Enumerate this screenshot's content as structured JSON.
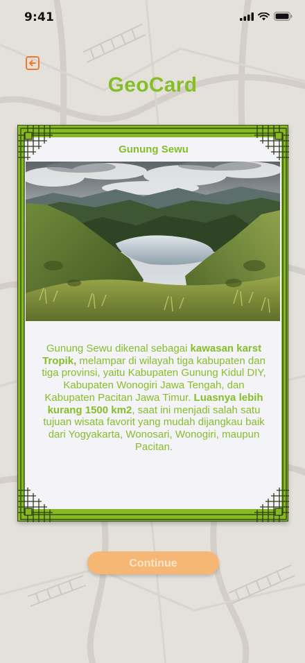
{
  "status_bar": {
    "time": "9:41"
  },
  "header": {
    "title": "GeoCard"
  },
  "card": {
    "title": "Gunung Sewu",
    "description_parts": [
      "Gunung Sewu dikenal sebagai ",
      "kawasan karst Tropik,",
      " melampar di wilayah tiga kabupaten dan tiga provinsi, yaitu Kabupaten Gunung Kidul DIY, Kabupaten Wonogiri Jawa Tengah, dan Kabupaten Pacitan Jawa Timur.  ",
      "Luasnya lebih kurang 1500 km2",
      ", saat ini menjadi salah satu tujuan wisata favorit yang mudah dijangkau baik dari Yogyakarta, Wonosari, Wonogiri, maupun Pacitan."
    ]
  },
  "actions": {
    "continue_label": "Continue"
  },
  "colors": {
    "accent": "#86be2a",
    "card_frame": "#84bb22",
    "button": "#f6b774",
    "back_icon": "#f07a2a"
  },
  "icons": {
    "back": "back-arrow-icon",
    "signal": "signal-icon",
    "wifi": "wifi-icon",
    "battery": "battery-icon"
  }
}
